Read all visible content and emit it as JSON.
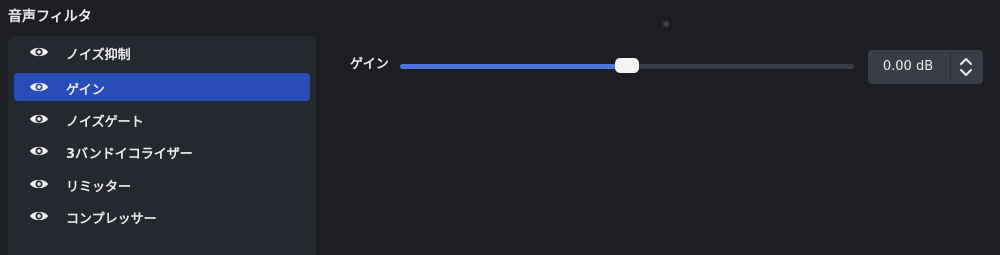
{
  "panel": {
    "title": "音声フィルタ"
  },
  "filters": [
    {
      "label": "ノイズ抑制",
      "visible": true,
      "selected": false
    },
    {
      "label": "ゲイン",
      "visible": true,
      "selected": true
    },
    {
      "label": "ノイズゲート",
      "visible": true,
      "selected": false
    },
    {
      "label": "3バンドイコライザー",
      "visible": true,
      "selected": false
    },
    {
      "label": "リミッター",
      "visible": true,
      "selected": false
    },
    {
      "label": "コンプレッサー",
      "visible": true,
      "selected": false
    }
  ],
  "gain": {
    "label": "ゲイン",
    "value_text": "0.00 dB",
    "slider_fraction": 0.5
  },
  "colors": {
    "background": "#1d1e24",
    "list_background": "#262830",
    "selected": "#284cb8",
    "slider_fill": "#4c74dc",
    "slider_track": "#3a3c45"
  },
  "icons": {
    "visibility": "eye-icon",
    "spin": "chevron-up-down-icon"
  }
}
